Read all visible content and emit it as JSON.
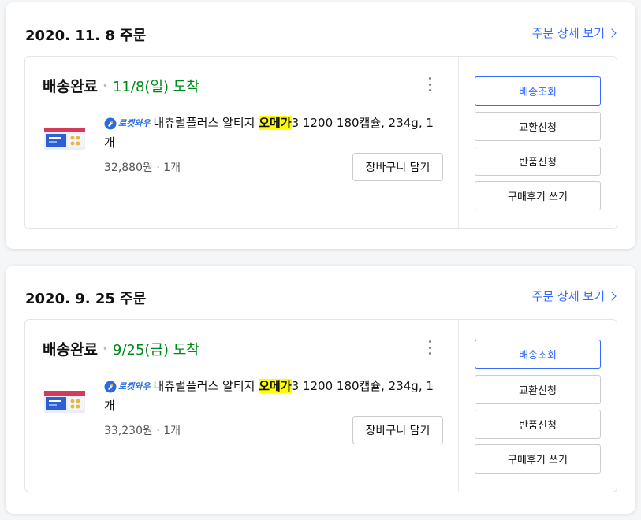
{
  "orders": [
    {
      "date_label": "2020. 11. 8 주문",
      "detail_link": "주문 상세 보기",
      "status": "배송완료",
      "arrival": "11/8(일) 도착",
      "rocket_badge": "로켓와우",
      "product_pre": "내츄럴플러스 알티지 ",
      "product_highlight": "오메가",
      "product_post": "3 1200 180캡슐, 234g, 1개",
      "price": "32,880원 · 1개",
      "cart_button": "장바구니 담기",
      "actions": [
        "배송조회",
        "교환신청",
        "반품신청",
        "구매후기 쓰기"
      ]
    },
    {
      "date_label": "2020. 9. 25 주문",
      "detail_link": "주문 상세 보기",
      "status": "배송완료",
      "arrival": "9/25(금) 도착",
      "rocket_badge": "로켓와우",
      "product_pre": "내츄럴플러스 알티지 ",
      "product_highlight": "오메가",
      "product_post": "3 1200 180캡슐, 234g, 1개",
      "price": "33,230원 · 1개",
      "cart_button": "장바구니 담기",
      "actions": [
        "배송조회",
        "교환신청",
        "반품신청",
        "구매후기 쓰기"
      ]
    }
  ],
  "colors": {
    "accent": "#346aff",
    "arrival_green": "#00891a",
    "highlight": "#ffff00"
  }
}
